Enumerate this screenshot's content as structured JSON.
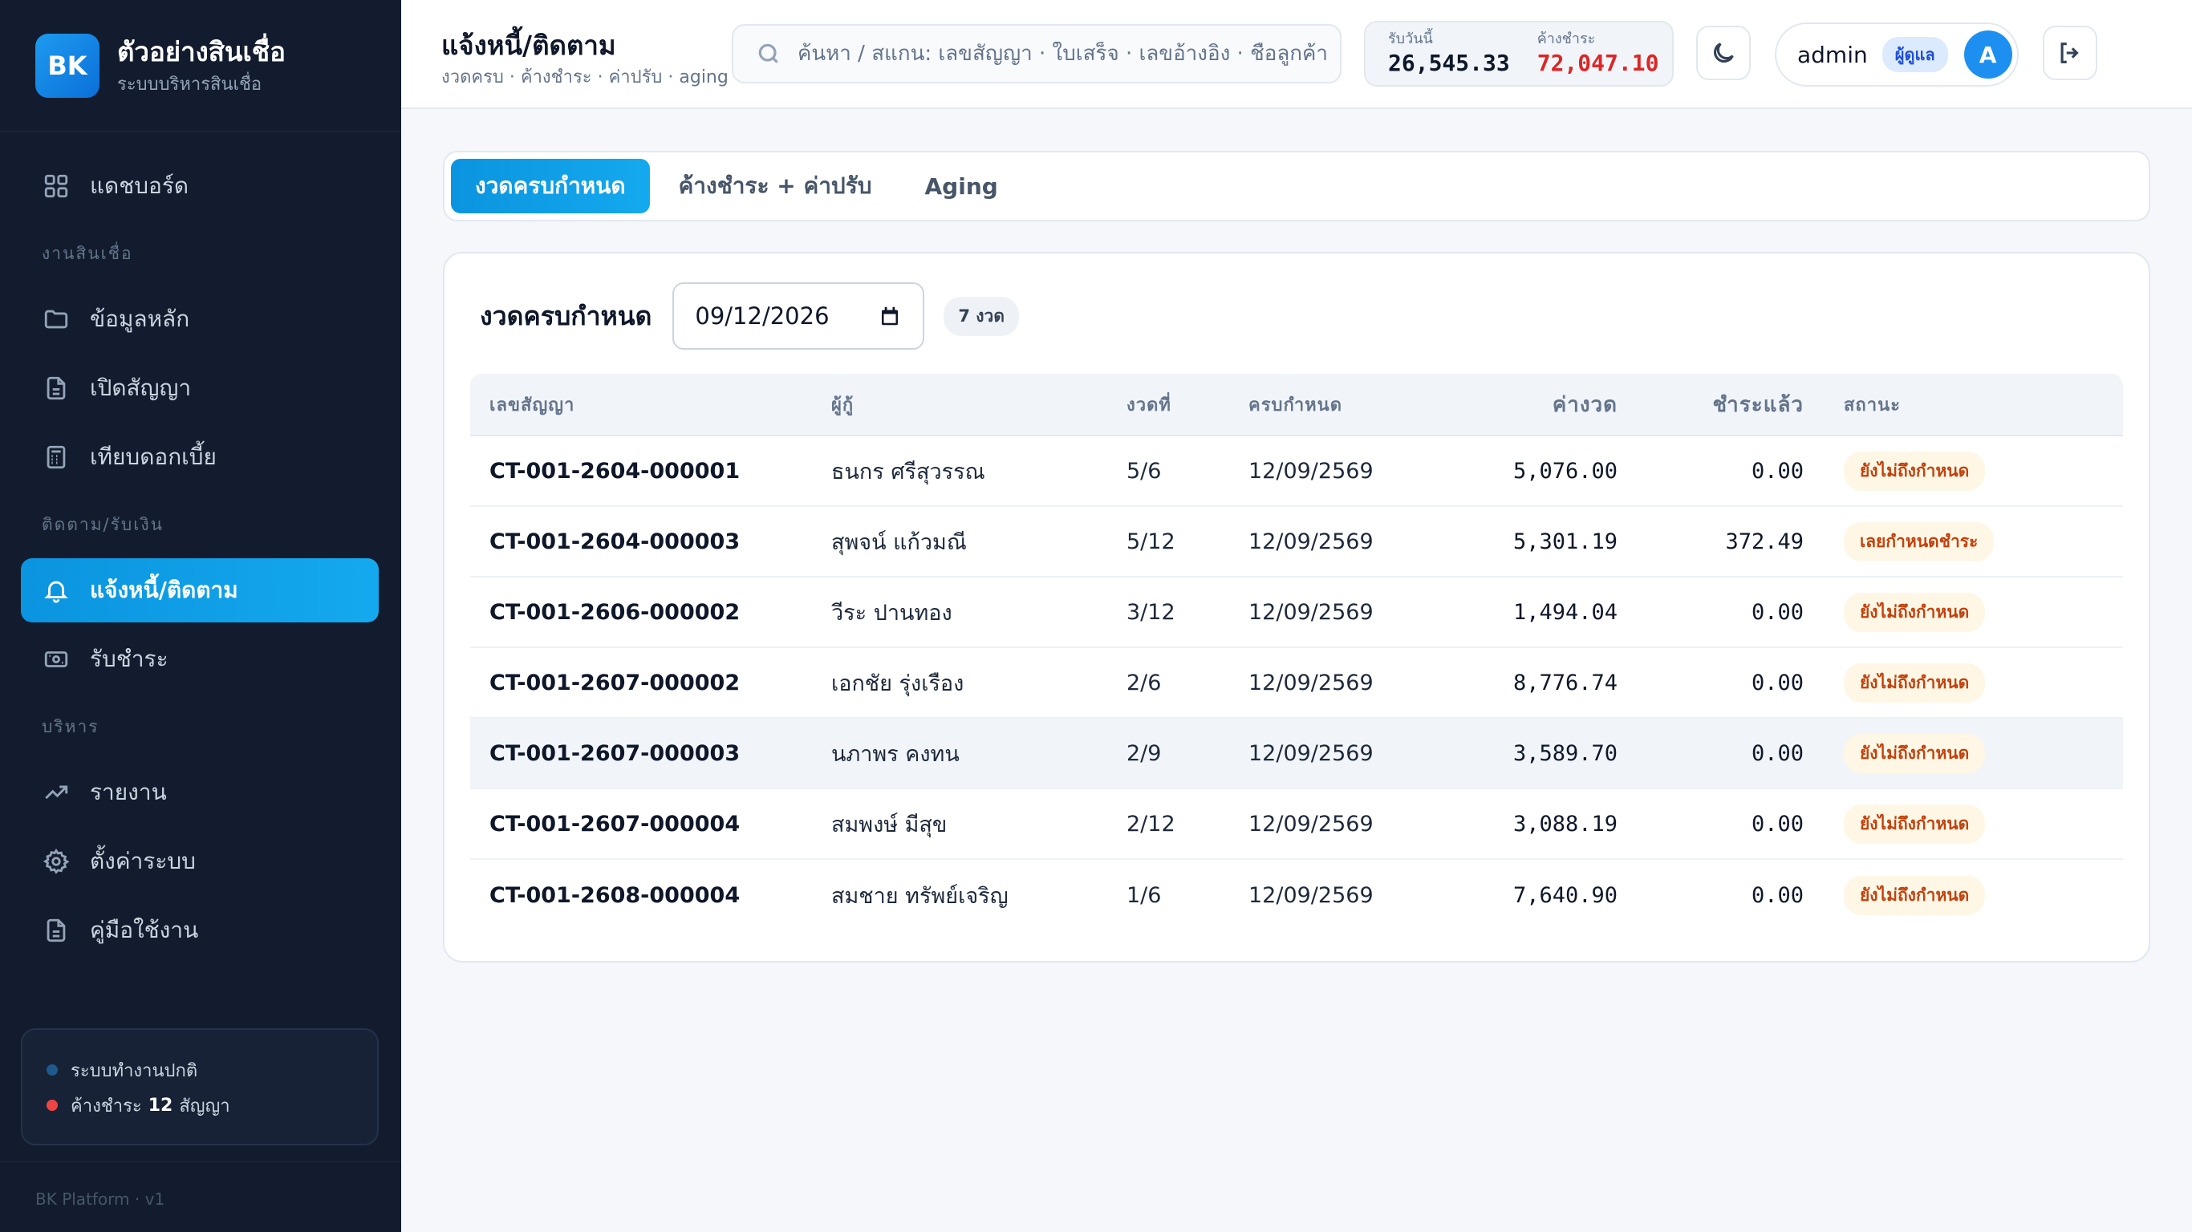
{
  "brand": {
    "logo": "BK",
    "title": "ตัวอย่างสินเชื่อ",
    "subtitle": "ระบบบริหารสินเชื่อ"
  },
  "nav": {
    "dashboard": "แดชบอร์ด",
    "section_loans": "งานสินเชื่อ",
    "master_data": "ข้อมูลหลัก",
    "open_contract": "เปิดสัญญา",
    "compare_interest": "เทียบดอกเบี้ย",
    "section_collect": "ติดตาม/รับเงิน",
    "notify": "แจ้งหนี้/ติดตาม",
    "receive": "รับชำระ",
    "section_admin": "บริหาร",
    "reports": "รายงาน",
    "settings": "ตั้งค่าระบบ",
    "manual": "คู่มือใช้งาน"
  },
  "sidebar_status": {
    "system_ok": "ระบบทำงานปกติ",
    "overdue_prefix": "ค้างชำระ",
    "overdue_count": "12",
    "overdue_suffix": "สัญญา",
    "footer": "BK Platform · v1"
  },
  "header": {
    "title": "แจ้งหนี้/ติดตาม",
    "subtitle": "งวดครบ · ค้างชำระ · ค่าปรับ · aging",
    "search_placeholder": "ค้นหา / สแกน: เลขสัญญา · ใบเสร็จ · เลขอ้างอิง · ชื่อลูกค้า",
    "today_label": "รับวันนี้",
    "today_value": "26,545.33",
    "overdue_label": "ค้างชำระ",
    "overdue_value": "72,047.10",
    "user_name": "admin",
    "user_role": "ผู้ดูแล",
    "avatar": "A"
  },
  "tabs": [
    "งวดครบกำหนด",
    "ค้างชำระ + ค่าปรับ",
    "Aging"
  ],
  "card": {
    "title": "งวดครบกำหนด",
    "date": "09/12/2026",
    "count": "7 งวด"
  },
  "table": {
    "headers": [
      "เลขสัญญา",
      "ผู้กู้",
      "งวดที่",
      "ครบกำหนด",
      "ค่างวด",
      "ชำระแล้ว",
      "สถานะ"
    ],
    "rows": [
      [
        "CT-001-2604-000001",
        "ธนกร ศรีสุวรรณ",
        "5/6",
        "12/09/2569",
        "5,076.00",
        "0.00",
        "ยังไม่ถึงกำหนด"
      ],
      [
        "CT-001-2604-000003",
        "สุพจน์ แก้วมณี",
        "5/12",
        "12/09/2569",
        "5,301.19",
        "372.49",
        "เลยกำหนดชำระ"
      ],
      [
        "CT-001-2606-000002",
        "วีระ ปานทอง",
        "3/12",
        "12/09/2569",
        "1,494.04",
        "0.00",
        "ยังไม่ถึงกำหนด"
      ],
      [
        "CT-001-2607-000002",
        "เอกชัย รุ่งเรือง",
        "2/6",
        "12/09/2569",
        "8,776.74",
        "0.00",
        "ยังไม่ถึงกำหนด"
      ],
      [
        "CT-001-2607-000003",
        "นภาพร คงทน",
        "2/9",
        "12/09/2569",
        "3,589.70",
        "0.00",
        "ยังไม่ถึงกำหนด"
      ],
      [
        "CT-001-2607-000004",
        "สมพงษ์ มีสุข",
        "2/12",
        "12/09/2569",
        "3,088.19",
        "0.00",
        "ยังไม่ถึงกำหนด"
      ],
      [
        "CT-001-2608-000004",
        "สมชาย ทรัพย์เจริญ",
        "1/6",
        "12/09/2569",
        "7,640.90",
        "0.00",
        "ยังไม่ถึงกำหนด"
      ]
    ]
  },
  "colors": {
    "accent": "#0ea5e9",
    "sidebar_bg": "#121c2e",
    "danger": "#dc2626",
    "pill_bg": "#fff7e6",
    "pill_text": "#c2410c"
  }
}
